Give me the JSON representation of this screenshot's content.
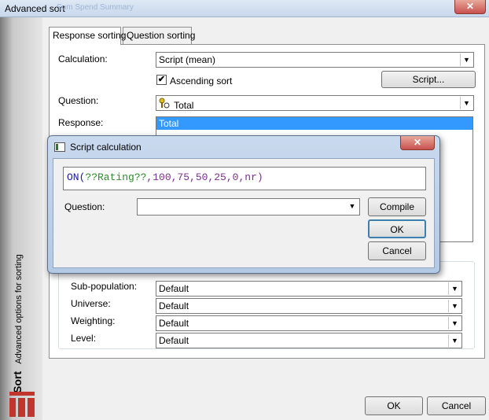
{
  "window": {
    "title": "Advanced sort",
    "ghost_title": "Sum Spend Summary",
    "close_glyph": "✕"
  },
  "sidebar": {
    "brand": "Sort",
    "subtitle": "Advanced options for sorting"
  },
  "tabs": [
    {
      "label": "Response sorting",
      "active": true
    },
    {
      "label": "Question sorting",
      "active": false
    }
  ],
  "form": {
    "calculation_label": "Calculation:",
    "calculation_value": "Script (mean)",
    "ascending_label": "Ascending sort",
    "ascending_checked": "✔",
    "script_button": "Script...",
    "question_label": "Question:",
    "question_value": "Total",
    "question_icon": "key-icon",
    "response_label": "Response:",
    "response_items": [
      "Total"
    ]
  },
  "options": {
    "subpopulation_label": "Sub-population:",
    "subpopulation_value": "Default",
    "universe_label": "Universe:",
    "universe_value": "Default",
    "weighting_label": "Weighting:",
    "weighting_value": "Default",
    "level_label": "Level:",
    "level_value": "Default"
  },
  "footer": {
    "ok_label": "OK",
    "cancel_label": "Cancel"
  },
  "dialog": {
    "title": "Script calculation",
    "close_glyph": "✕",
    "script": {
      "fn": "ON(",
      "arg": "??Rating??",
      "rest": ",100,75,50,25,0,nr)"
    },
    "question_label": "Question:",
    "question_value": "",
    "compile_label": "Compile",
    "ok_label": "OK",
    "cancel_label": "Cancel"
  },
  "colors": {
    "selection": "#3399ff",
    "script_keyword": "#1a1aa6",
    "script_variable": "#2e8b2e",
    "script_literal": "#7b2e8e",
    "close_red": "#c75050",
    "brand_red": "#c0362c"
  }
}
